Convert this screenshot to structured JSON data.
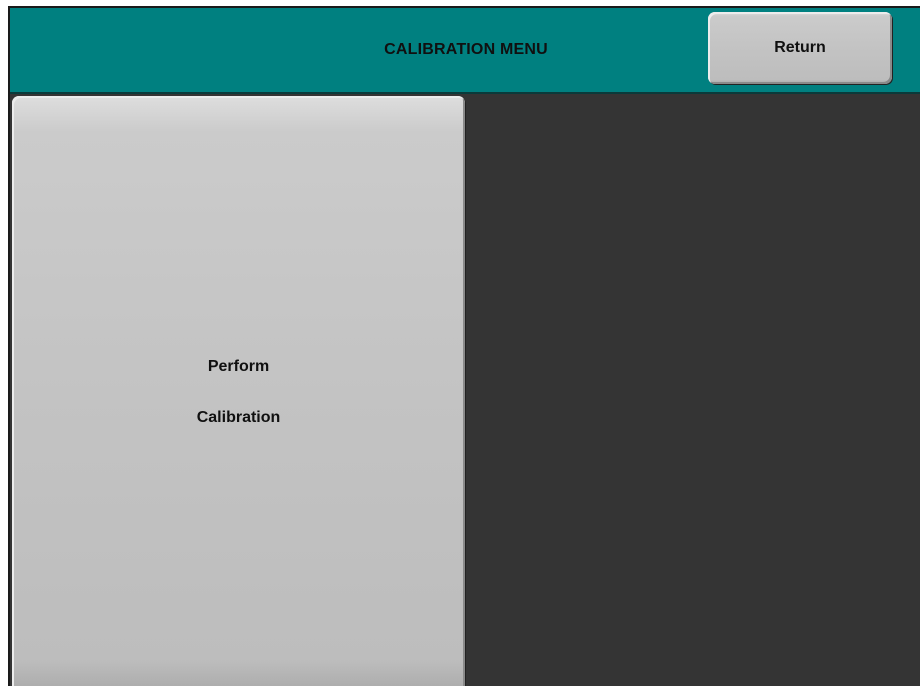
{
  "header": {
    "title": "CALIBRATION MENU",
    "return_label": "Return"
  },
  "main": {
    "perform_label_line1": "Perform",
    "perform_label_line2": "Calibration"
  },
  "colors": {
    "header_bg": "#008080",
    "screen_bg": "#343434",
    "button_bg": "#c3c3c3"
  }
}
